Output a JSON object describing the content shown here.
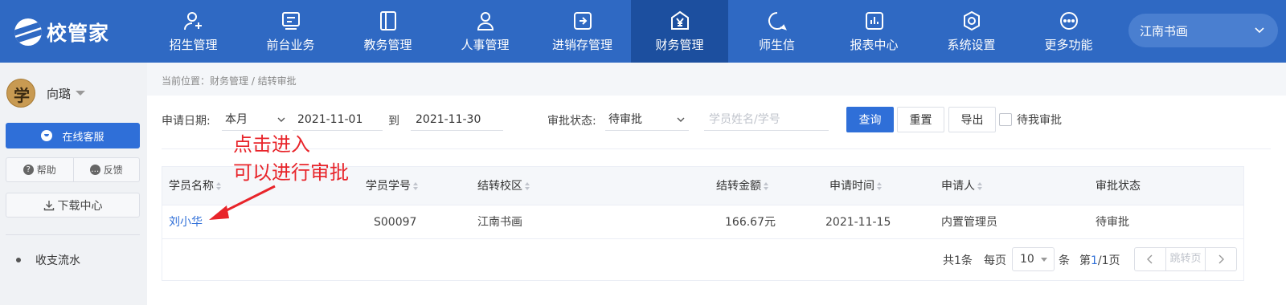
{
  "app": {
    "logo_text": "校管家"
  },
  "nav": {
    "items": [
      {
        "label": "招生管理",
        "icon": "user-add-icon"
      },
      {
        "label": "前台业务",
        "icon": "desk-icon"
      },
      {
        "label": "教务管理",
        "icon": "book-icon"
      },
      {
        "label": "人事管理",
        "icon": "person-icon"
      },
      {
        "label": "进销存管理",
        "icon": "inventory-icon"
      },
      {
        "label": "财务管理",
        "icon": "yuan-icon",
        "active": true
      },
      {
        "label": "师生信",
        "icon": "chat-icon"
      },
      {
        "label": "报表中心",
        "icon": "report-icon"
      },
      {
        "label": "系统设置",
        "icon": "settings-icon"
      },
      {
        "label": "更多功能",
        "icon": "more-icon"
      }
    ],
    "campus": "江南书画"
  },
  "sidebar": {
    "user_name": "向璐",
    "avatar_char": "学",
    "service_label": "在线客服",
    "help_label": "帮助",
    "feedback_label": "反馈",
    "download_label": "下载中心",
    "menu": [
      {
        "label": "收支流水"
      }
    ]
  },
  "breadcrumb": "当前位置：财务管理 / 结转审批",
  "filters": {
    "date_label": "申请日期:",
    "period_value": "本月",
    "date_from": "2021-11-01",
    "to_label": "到",
    "date_to": "2021-11-30",
    "status_label": "审批状态:",
    "status_value": "待审批",
    "student_placeholder": "学员姓名/学号",
    "query_label": "查询",
    "reset_label": "重置",
    "export_label": "导出",
    "pending_mine_label": "待我审批"
  },
  "table": {
    "headers": [
      "学员名称",
      "学员学号",
      "结转校区",
      "结转金额",
      "申请时间",
      "申请人",
      "审批状态"
    ],
    "rows": [
      [
        "刘小华",
        "S00097",
        "江南书画",
        "166.67元",
        "2021-11-15",
        "内置管理员",
        "待审批"
      ]
    ]
  },
  "pagination": {
    "total_text": "共1条",
    "per_page_label": "每页",
    "page_size": "10",
    "unit_label": "条",
    "page_prefix": "第",
    "current_page": "1",
    "page_suffix": "/1页",
    "jump_placeholder": "跳转页"
  },
  "annotation": {
    "line1": "点击进入",
    "line2": "可以进行审批",
    "color": "#e8242a"
  },
  "colors": {
    "nav_bg": "#2f69c3",
    "nav_active": "#1c4f9f",
    "primary": "#2f6fd8"
  }
}
